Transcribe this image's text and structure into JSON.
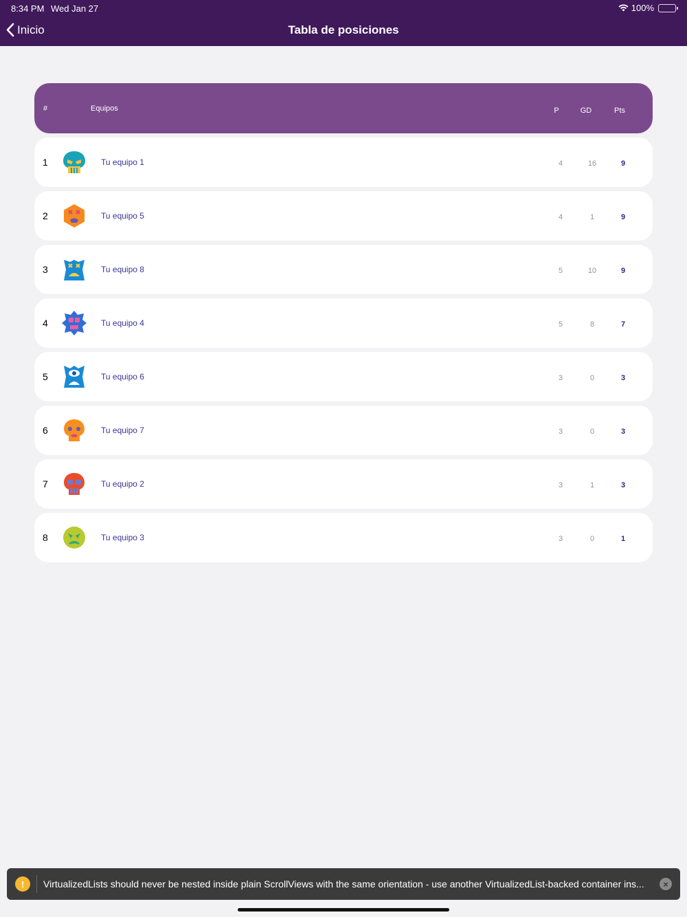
{
  "status": {
    "time": "8:34 PM",
    "date": "Wed Jan 27",
    "battery": "100%"
  },
  "nav": {
    "back_label": "Inicio",
    "title": "Tabla de posiciones"
  },
  "table": {
    "headers": {
      "rank": "#",
      "team": "Equipos",
      "p": "P",
      "gd": "GD",
      "pts": "Pts"
    },
    "rows": [
      {
        "rank": "1",
        "team": "Tu equipo 1",
        "p": "4",
        "gd": "16",
        "pts": "9",
        "logo": "teal-skull-icon"
      },
      {
        "rank": "2",
        "team": "Tu equipo 5",
        "p": "4",
        "gd": "1",
        "pts": "9",
        "logo": "orange-hexagon-face-icon"
      },
      {
        "rank": "3",
        "team": "Tu equipo 8",
        "p": "5",
        "gd": "10",
        "pts": "9",
        "logo": "blue-monster-face-icon"
      },
      {
        "rank": "4",
        "team": "Tu equipo 4",
        "p": "5",
        "gd": "8",
        "pts": "7",
        "logo": "blue-spiky-face-icon"
      },
      {
        "rank": "5",
        "team": "Tu equipo 6",
        "p": "3",
        "gd": "0",
        "pts": "3",
        "logo": "blue-eye-face-icon"
      },
      {
        "rank": "6",
        "team": "Tu equipo 7",
        "p": "3",
        "gd": "0",
        "pts": "3",
        "logo": "orange-skull-icon"
      },
      {
        "rank": "7",
        "team": "Tu equipo 2",
        "p": "3",
        "gd": "1",
        "pts": "3",
        "logo": "red-skull-icon"
      },
      {
        "rank": "8",
        "team": "Tu equipo 3",
        "p": "3",
        "gd": "0",
        "pts": "1",
        "logo": "green-round-face-icon"
      }
    ]
  },
  "toast": {
    "icon": "!",
    "message": "VirtualizedLists should never be nested inside plain ScrollViews with the same orientation - use another VirtualizedList-backed container ins...",
    "close": "×"
  },
  "colors": {
    "nav_bg": "#40195b",
    "header_bg": "#7a4a8d",
    "team_text": "#3a3596",
    "pts_text": "#2a2a8c"
  }
}
